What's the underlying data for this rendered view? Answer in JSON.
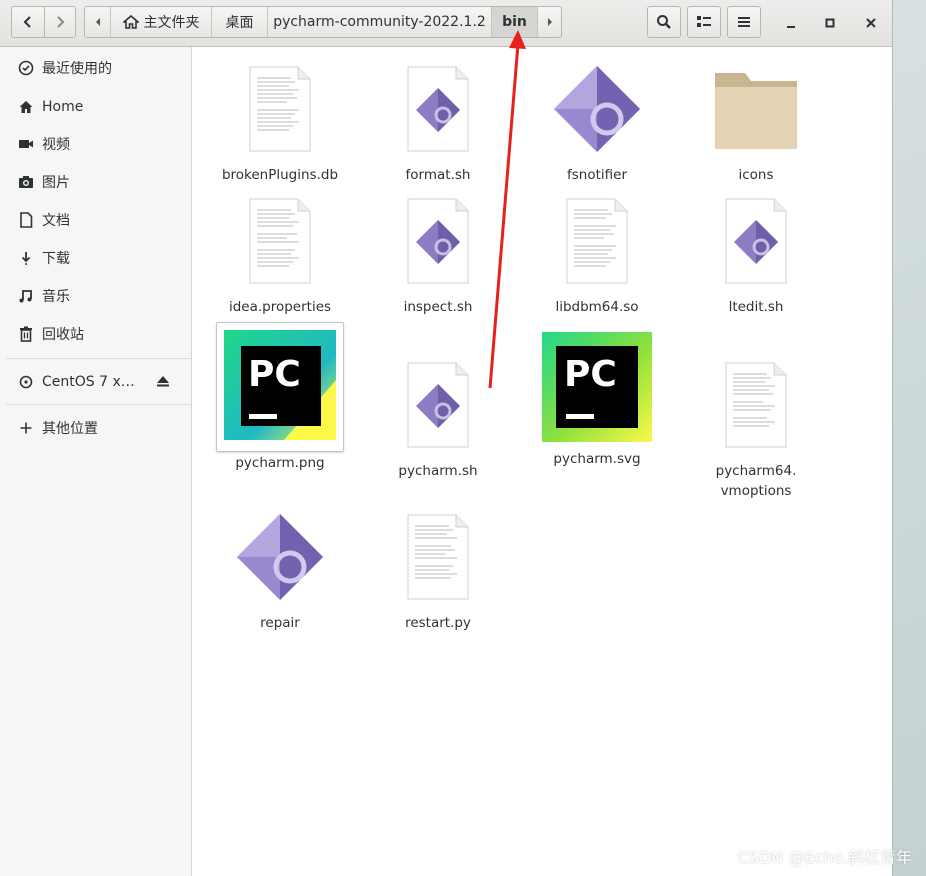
{
  "pathbar": {
    "items": [
      {
        "label": "主文件夹",
        "icon": "home-icon"
      },
      {
        "label": "桌面"
      },
      {
        "label": "pycharm-community-2022.1.2"
      },
      {
        "label": "bin",
        "active": true
      }
    ]
  },
  "sidebar": {
    "items": [
      {
        "label": "最近使用的",
        "icon": "recent-icon"
      },
      {
        "label": "Home",
        "icon": "home-icon"
      },
      {
        "label": "视频",
        "icon": "video-icon"
      },
      {
        "label": "图片",
        "icon": "camera-icon"
      },
      {
        "label": "文档",
        "icon": "document-icon"
      },
      {
        "label": "下载",
        "icon": "download-icon"
      },
      {
        "label": "音乐",
        "icon": "music-icon"
      },
      {
        "label": "回收站",
        "icon": "trash-icon"
      }
    ],
    "device": {
      "label": "CentOS 7 x…",
      "icon": "disc-icon",
      "eject_icon": "eject-icon"
    },
    "other": {
      "label": "其他位置",
      "icon": "plus-icon"
    }
  },
  "files": [
    {
      "name": "brokenPlugins.db",
      "type": "text"
    },
    {
      "name": "format.sh",
      "type": "script"
    },
    {
      "name": "fsnotifier",
      "type": "executable"
    },
    {
      "name": "icons",
      "type": "folder"
    },
    {
      "name": "idea.properties",
      "type": "text"
    },
    {
      "name": "inspect.sh",
      "type": "script"
    },
    {
      "name": "libdbm64.so",
      "type": "text"
    },
    {
      "name": "ltedit.sh",
      "type": "script"
    },
    {
      "name": "pycharm.png",
      "type": "pycharm-png"
    },
    {
      "name": "pycharm.sh",
      "type": "script"
    },
    {
      "name": "pycharm.svg",
      "type": "pycharm-svg"
    },
    {
      "name": "pycharm64.\nvmoptions",
      "type": "text"
    },
    {
      "name": "repair",
      "type": "executable"
    },
    {
      "name": "restart.py",
      "type": "text"
    }
  ],
  "watermark": "CSDN @Echo.斜杠青年",
  "colors": {
    "annotation_arrow": "#e8201b",
    "script_icon": "#8d7cc4",
    "folder": "#d9c7a4",
    "pycharm_green": "#21d789",
    "pycharm_yellow": "#fcf84a"
  }
}
